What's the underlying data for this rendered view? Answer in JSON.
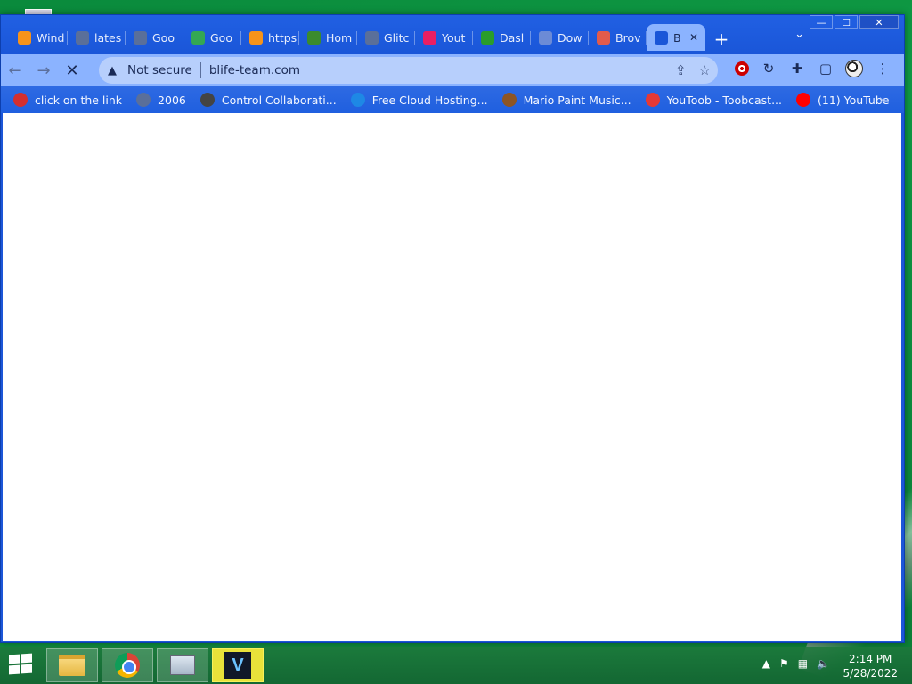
{
  "window": {
    "controls": {
      "minimize": "—",
      "maximize": "☐",
      "close": "✕"
    }
  },
  "tabs": [
    {
      "label": "Wind",
      "icon": "bitcoin-icon",
      "color": "#f7931a"
    },
    {
      "label": "lates",
      "icon": "globe-icon",
      "color": "#5a6f9a"
    },
    {
      "label": "Goo",
      "icon": "globe-icon",
      "color": "#5a6f9a"
    },
    {
      "label": "Goo",
      "icon": "google-icon",
      "color": "#34a853"
    },
    {
      "label": "https",
      "icon": "bitcoin-icon",
      "color": "#f7931a"
    },
    {
      "label": "Hom",
      "icon": "home-icon",
      "color": "#3b8b2e"
    },
    {
      "label": "Glitc",
      "icon": "globe-icon",
      "color": "#5a6f9a"
    },
    {
      "label": "Yout",
      "icon": "download-icon",
      "color": "#e91e63"
    },
    {
      "label": "Dasl",
      "icon": "play-icon",
      "color": "#2a9d2a"
    },
    {
      "label": "Dow",
      "icon": "download-arrow-icon",
      "color": "#6c8bd6"
    },
    {
      "label": "Brov",
      "icon": "browser-icon",
      "color": "#e25b4b"
    },
    {
      "label": "B",
      "icon": "loading-icon",
      "color": "#1a56d8",
      "active": true
    }
  ],
  "toolbar": {
    "back": "←",
    "forward": "→",
    "stop": "✕",
    "security_warning": "▲",
    "security_label": "Not secure",
    "url": "blife-team.com",
    "share": "⇪",
    "star": "☆",
    "refresh": "↻",
    "extensions": "✚",
    "sidepanel": "▢",
    "menu": "⋮"
  },
  "bookmarks": [
    {
      "label": "click on the link",
      "icon": "error-icon",
      "color": "#d32f2f"
    },
    {
      "label": "2006",
      "icon": "globe-icon",
      "color": "#5a6f9a"
    },
    {
      "label": "Control Collaborati...",
      "icon": "collab-icon",
      "color": "#444444"
    },
    {
      "label": "Free Cloud Hosting...",
      "icon": "vercel-icon",
      "color": "#1e88e5"
    },
    {
      "label": "Mario Paint Music...",
      "icon": "mario-icon",
      "color": "#8d5524"
    },
    {
      "label": "YouToob - Toobcast...",
      "icon": "toob-icon",
      "color": "#e53935"
    },
    {
      "label": "(11) YouTube",
      "icon": "youtube-icon",
      "color": "#ff0000"
    }
  ],
  "bookmarks_more": "»",
  "taskbar": {
    "apps": [
      "file-explorer",
      "chrome",
      "system-monitor",
      "v-app"
    ],
    "v_label": "V",
    "tray_chevron": "▲",
    "time": "2:14 PM",
    "date": "5/28/2022"
  }
}
